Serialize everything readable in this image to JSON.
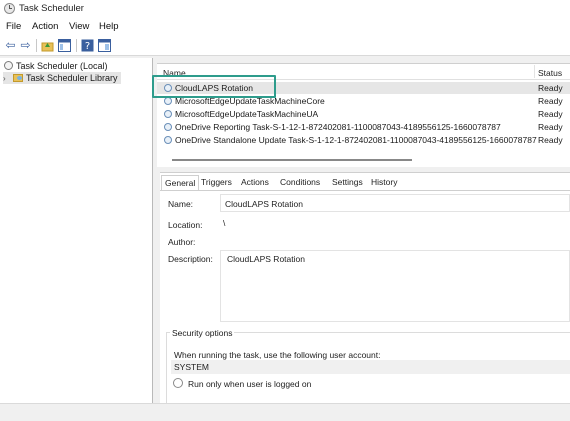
{
  "window": {
    "title": "Task Scheduler"
  },
  "menu": {
    "items": [
      "File",
      "Action",
      "View",
      "Help"
    ]
  },
  "toolbar": {
    "back_icon": "back-arrow-icon",
    "forward_icon": "forward-arrow-icon"
  },
  "tree": {
    "root_label": "Task Scheduler (Local)",
    "library_label": "Task Scheduler Library"
  },
  "task_list": {
    "columns": [
      "Name",
      "Status"
    ],
    "rows": [
      {
        "name": "CloudLAPS Rotation",
        "status": "Ready"
      },
      {
        "name": "MicrosoftEdgeUpdateTaskMachineCore",
        "status": "Ready"
      },
      {
        "name": "MicrosoftEdgeUpdateTaskMachineUA",
        "status": "Ready"
      },
      {
        "name": "OneDrive Reporting Task-S-1-12-1-872402081-1100087043-4189556125-1660078787",
        "status": "Ready"
      },
      {
        "name": "OneDrive Standalone Update Task-S-1-12-1-872402081-1100087043-4189556125-1660078787",
        "status": "Ready"
      }
    ],
    "highlight_color": "#2e9c8c"
  },
  "detail": {
    "tabs": [
      "General",
      "Triggers",
      "Actions",
      "Conditions",
      "Settings",
      "History"
    ],
    "name_label": "Name:",
    "name_value": "CloudLAPS Rotation",
    "location_label": "Location:",
    "location_value": "\\",
    "author_label": "Author:",
    "description_label": "Description:",
    "description_value": "CloudLAPS Rotation",
    "security": {
      "title": "Security options",
      "account_prompt": "When running the task, use the following user account:",
      "account": "SYSTEM",
      "run_option": "Run only when user is logged on"
    }
  }
}
